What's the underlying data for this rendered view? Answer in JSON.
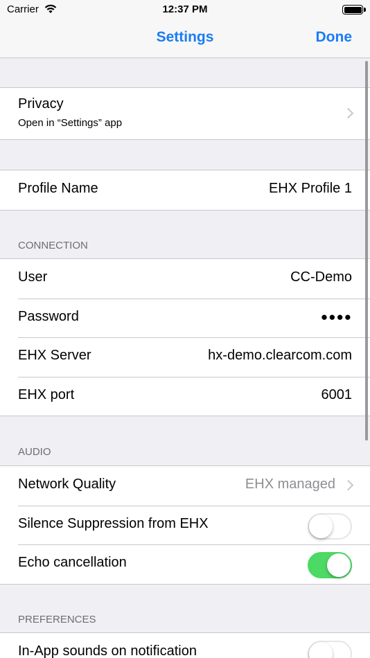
{
  "status_bar": {
    "carrier": "Carrier",
    "time": "12:37 PM"
  },
  "nav": {
    "title": "Settings",
    "done": "Done"
  },
  "privacy": {
    "label": "Privacy",
    "subtitle": "Open in “Settings” app"
  },
  "profile": {
    "label": "Profile Name",
    "value": "EHX Profile 1"
  },
  "connection": {
    "header": "CONNECTION",
    "user_label": "User",
    "user_value": "CC-Demo",
    "password_label": "Password",
    "password_value": "●●●●",
    "server_label": "EHX Server",
    "server_value": "hx-demo.clearcom.com",
    "port_label": "EHX port",
    "port_value": "6001"
  },
  "audio": {
    "header": "AUDIO",
    "network_label": "Network Quality",
    "network_value": "EHX managed",
    "silence_label": "Silence Suppression from EHX",
    "silence_on": false,
    "echo_label": "Echo cancellation",
    "echo_on": true
  },
  "preferences": {
    "header": "PREFERENCES",
    "sounds_label": "In-App sounds on notification",
    "sounds_on": false
  },
  "colors": {
    "accent": "#1a7cf5",
    "toggle_on": "#4cd964",
    "background": "#efeff4"
  },
  "icons": {
    "wifi": "wifi-icon",
    "battery": "battery-icon",
    "chevron": "chevron-right-icon"
  }
}
